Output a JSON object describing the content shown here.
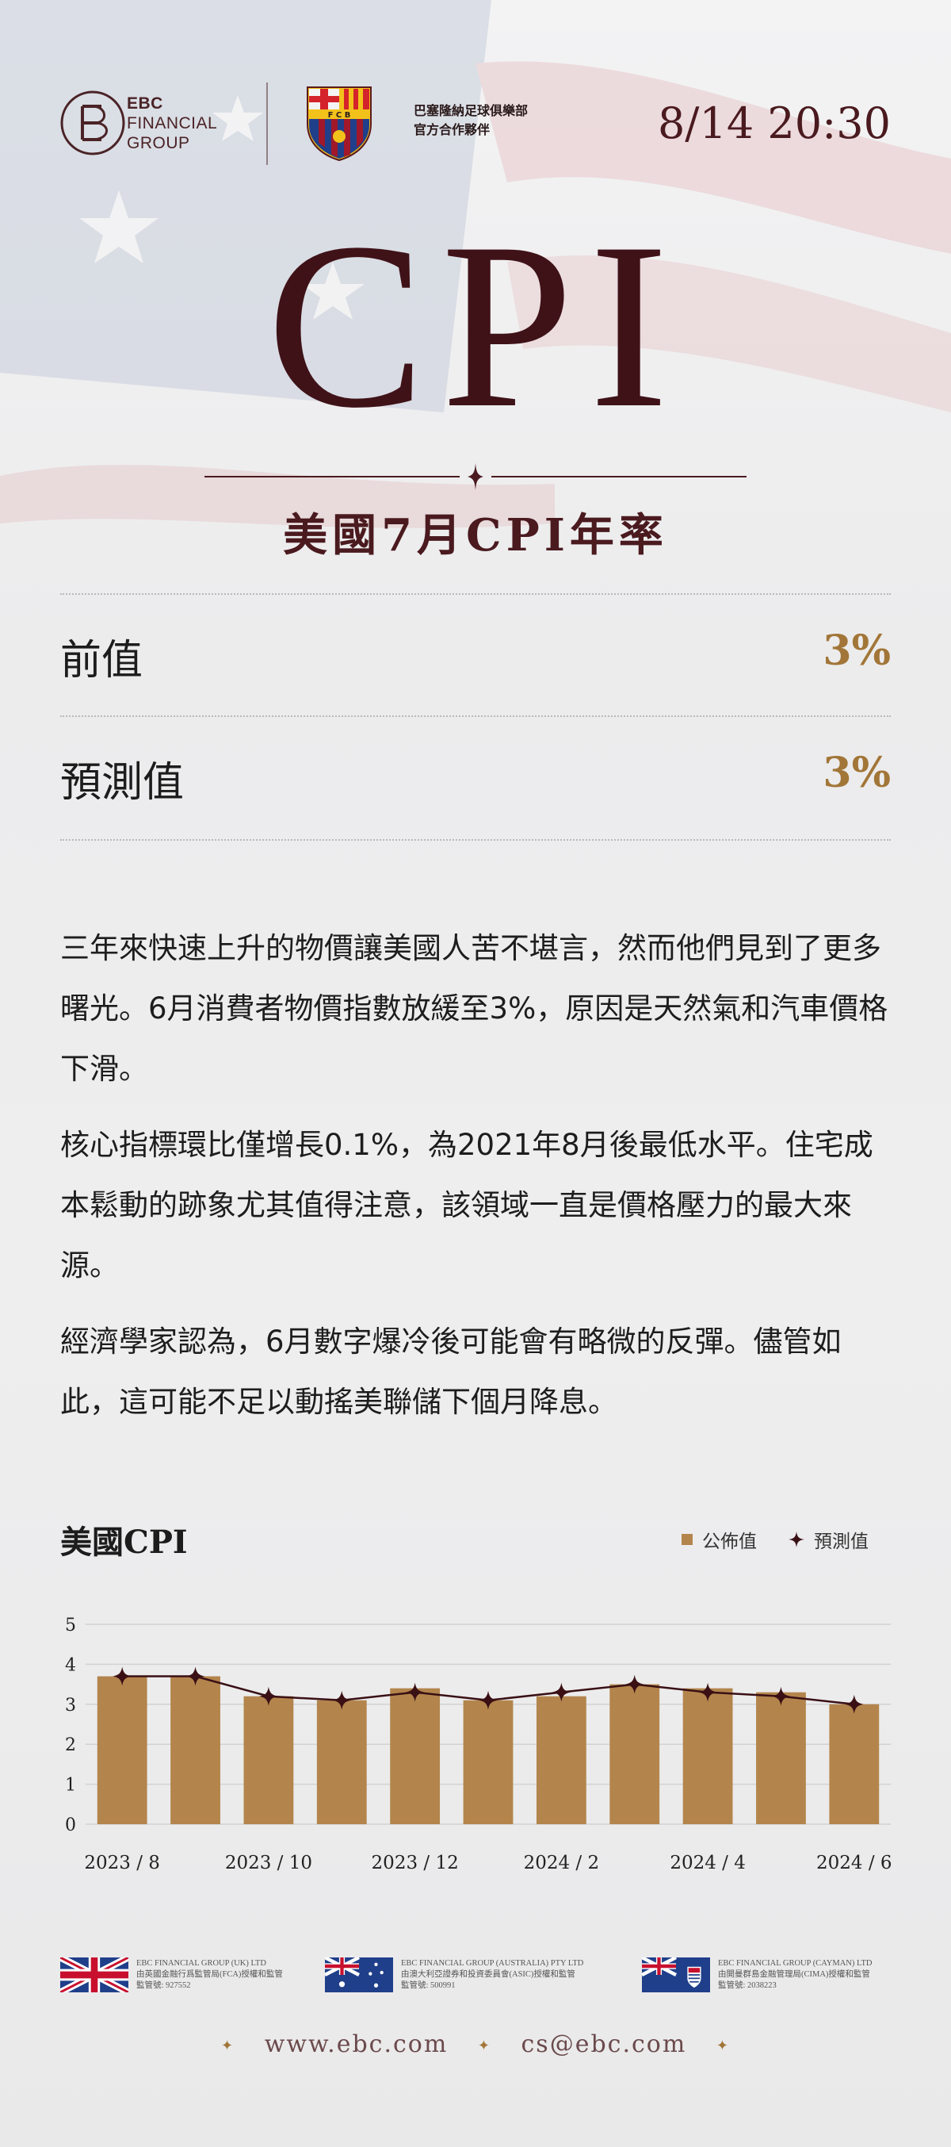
{
  "header": {
    "brand_line1": "EBC",
    "brand_line2": "FINANCIAL",
    "brand_line3": "GROUP",
    "partner_line1": "巴塞隆納足球俱樂部",
    "partner_line2": "官方合作夥伴",
    "datetime": "8/14 20:30"
  },
  "hero": {
    "title": "CPI",
    "subtitle": "美國7月CPI年率"
  },
  "metrics": [
    {
      "label": "前值",
      "value": "3%"
    },
    {
      "label": "預測值",
      "value": "3%"
    }
  ],
  "body": {
    "p1": "三年來快速上升的物價讓美國人苦不堪言，然而他們見到了更多曙光。6月消費者物價指數放緩至3%，原因是天然氣和汽車價格下滑。",
    "p2": "核心指標環比僅增長0.1%，為2021年8月後最低水平。住宅成本鬆動的跡象尤其值得注意，該領域一直是價格壓力的最大來源。",
    "p3": "經濟學家認為，6月數字爆冷後可能會有略微的反彈。儘管如此，這可能不足以動搖美聯儲下個月降息。"
  },
  "chart_data": {
    "type": "bar",
    "title": "美國CPI",
    "categories": [
      "2023 / 8",
      "2023 / 9",
      "2023 / 10",
      "2023 / 11",
      "2023 / 12",
      "2024 / 1",
      "2024 / 2",
      "2024 / 3",
      "2024 / 4",
      "2024 / 5",
      "2024 / 6"
    ],
    "x_tick_labels": [
      "2023 / 8",
      "2023 / 10",
      "2023 / 12",
      "2024 / 2",
      "2024 / 4",
      "2024 / 6"
    ],
    "series": [
      {
        "name": "公佈值",
        "type": "bar",
        "color": "#b3854c",
        "values": [
          3.7,
          3.7,
          3.2,
          3.1,
          3.4,
          3.1,
          3.2,
          3.5,
          3.4,
          3.3,
          3.0
        ]
      },
      {
        "name": "預測值",
        "type": "line",
        "color": "#3a1015",
        "values": [
          3.7,
          3.7,
          3.2,
          3.1,
          3.3,
          3.1,
          3.3,
          3.5,
          3.3,
          3.2,
          3.0
        ]
      }
    ],
    "ylim": [
      0,
      5
    ],
    "yticks": [
      0,
      1,
      2,
      3,
      4,
      5
    ],
    "grid": true,
    "legend": "top-right"
  },
  "regulators": [
    {
      "name": "EBC FINANCIAL GROUP (UK) LTD",
      "line2": "由英國金融行爲監管局(FCA)授權和監管",
      "line3": "監管號: 927552"
    },
    {
      "name": "EBC FINANCIAL GROUP (AUSTRALIA) PTY LTD",
      "line2": "由澳大利亞證券和投資委員會(ASIC)授權和監管",
      "line3": "監管號: 500991"
    },
    {
      "name": "EBC FINANCIAL GROUP (CAYMAN) LTD",
      "line2": "由開曼群島金融管理局(CIMA)授權和監管",
      "line3": "監管號: 2038223"
    }
  ],
  "footer": {
    "website": "www.ebc.com",
    "email": "cs@ebc.com"
  }
}
